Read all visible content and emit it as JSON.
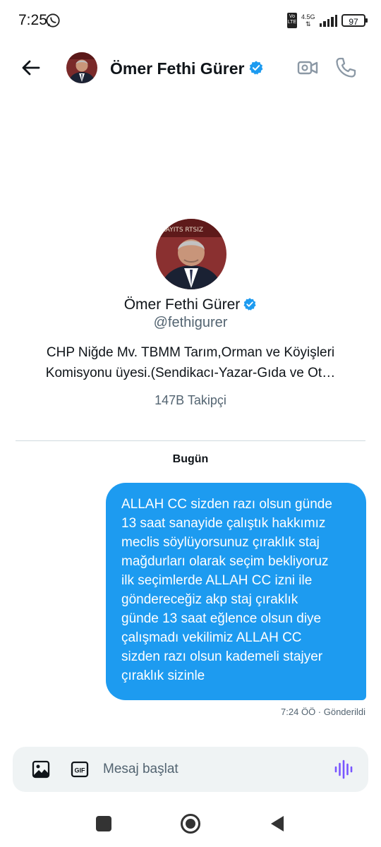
{
  "status_bar": {
    "time": "7:25",
    "network_type": "4.5G",
    "volte": "Vo LTE",
    "battery": "97"
  },
  "header": {
    "name": "Ömer Fethi Gürer",
    "verified": true
  },
  "profile": {
    "name": "Ömer Fethi Gürer",
    "handle": "@fethigurer",
    "bio_line1": "CHP Niğde Mv. TBMM Tarım,Orman ve Köyişleri",
    "bio_line2": "Komisyonu üyesi.(Sendikacı-Yazar-Gıda ve Ot…",
    "followers": "147B Takipçi"
  },
  "conversation": {
    "date_label": "Bugün",
    "messages": [
      {
        "lines": [
          "ALLAH CC sizden razı olsun günde",
          "13 saat sanayide çalıştık hakkımız",
          "meclis söylüyorsunuz çıraklık staj",
          "mağdurları olarak seçim bekliyoruz",
          "ilk seçimlerde ALLAH CC izni ile",
          "göndereceğiz akp staj çıraklık",
          "günde 13 saat eğlence olsun diye",
          "çalışmadı vekilimiz ALLAH CC",
          "sizden razı olsun kademeli stajyer",
          "çıraklık sizinle"
        ],
        "meta": "7:24 ÖÖ · Gönderildi"
      }
    ]
  },
  "composer": {
    "placeholder": "Mesaj başlat",
    "gif_label": "GIF"
  },
  "colors": {
    "accent": "#1d9bf0",
    "voice": "#7856ff",
    "secondary_text": "#536471"
  },
  "icons": [
    "whatsapp-icon",
    "signal-icon",
    "battery-icon",
    "back-arrow-icon",
    "verified-badge-icon",
    "video-camera-icon",
    "phone-icon",
    "image-icon",
    "gif-icon",
    "voice-wave-icon"
  ]
}
